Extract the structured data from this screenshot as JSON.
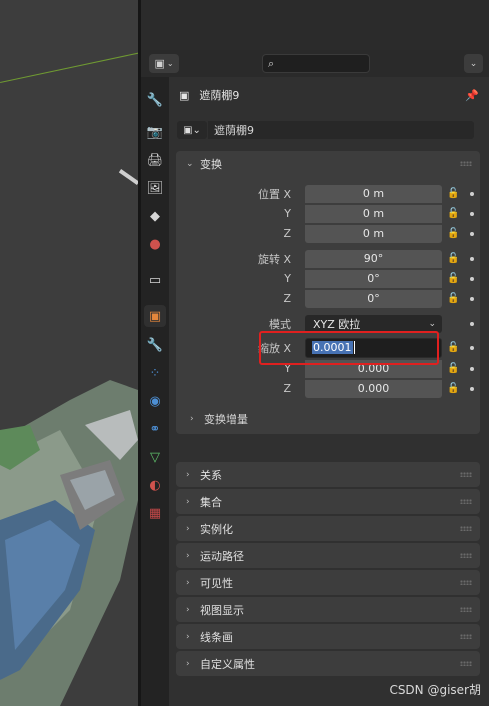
{
  "header": {
    "search_placeholder": "",
    "editor_type_icon": "properties-editor-icon",
    "options_icon": "chevron-down-icon"
  },
  "tabs": [
    "tool-icon",
    "render-icon",
    "output-icon",
    "view-layer-icon",
    "scene-icon",
    "world-icon",
    "collection-icon",
    "object-icon",
    "modifier-icon",
    "particles-icon",
    "physics-icon",
    "constraints-icon",
    "data-icon",
    "material-icon",
    "texture-icon"
  ],
  "object": {
    "breadcrumb_name": "遮荫棚9",
    "name_field_value": "遮荫棚9"
  },
  "transform": {
    "title": "变换",
    "location_label": "位置 X",
    "location": {
      "x": "0 m",
      "y": "0 m",
      "z": "0 m"
    },
    "rotation_label": "旋转 X",
    "rotation": {
      "x": "90°",
      "y": "0°",
      "z": "0°"
    },
    "axis_y": "Y",
    "axis_z": "Z",
    "mode_label": "模式",
    "mode_value": "XYZ 欧拉",
    "scale_label": "缩放 X",
    "scale": {
      "x": "0.0001",
      "y": "0.000",
      "z": "0.000"
    },
    "delta_title": "变换增量"
  },
  "collapsed_panels": [
    "关系",
    "集合",
    "实例化",
    "运动路径",
    "可见性",
    "视图显示",
    "线条画",
    "自定义属性"
  ],
  "watermark": "CSDN @giser胡",
  "colors": {
    "highlight_border": "#e0201f",
    "selection": "#4772b3",
    "accent_orange": "#e3863c"
  }
}
